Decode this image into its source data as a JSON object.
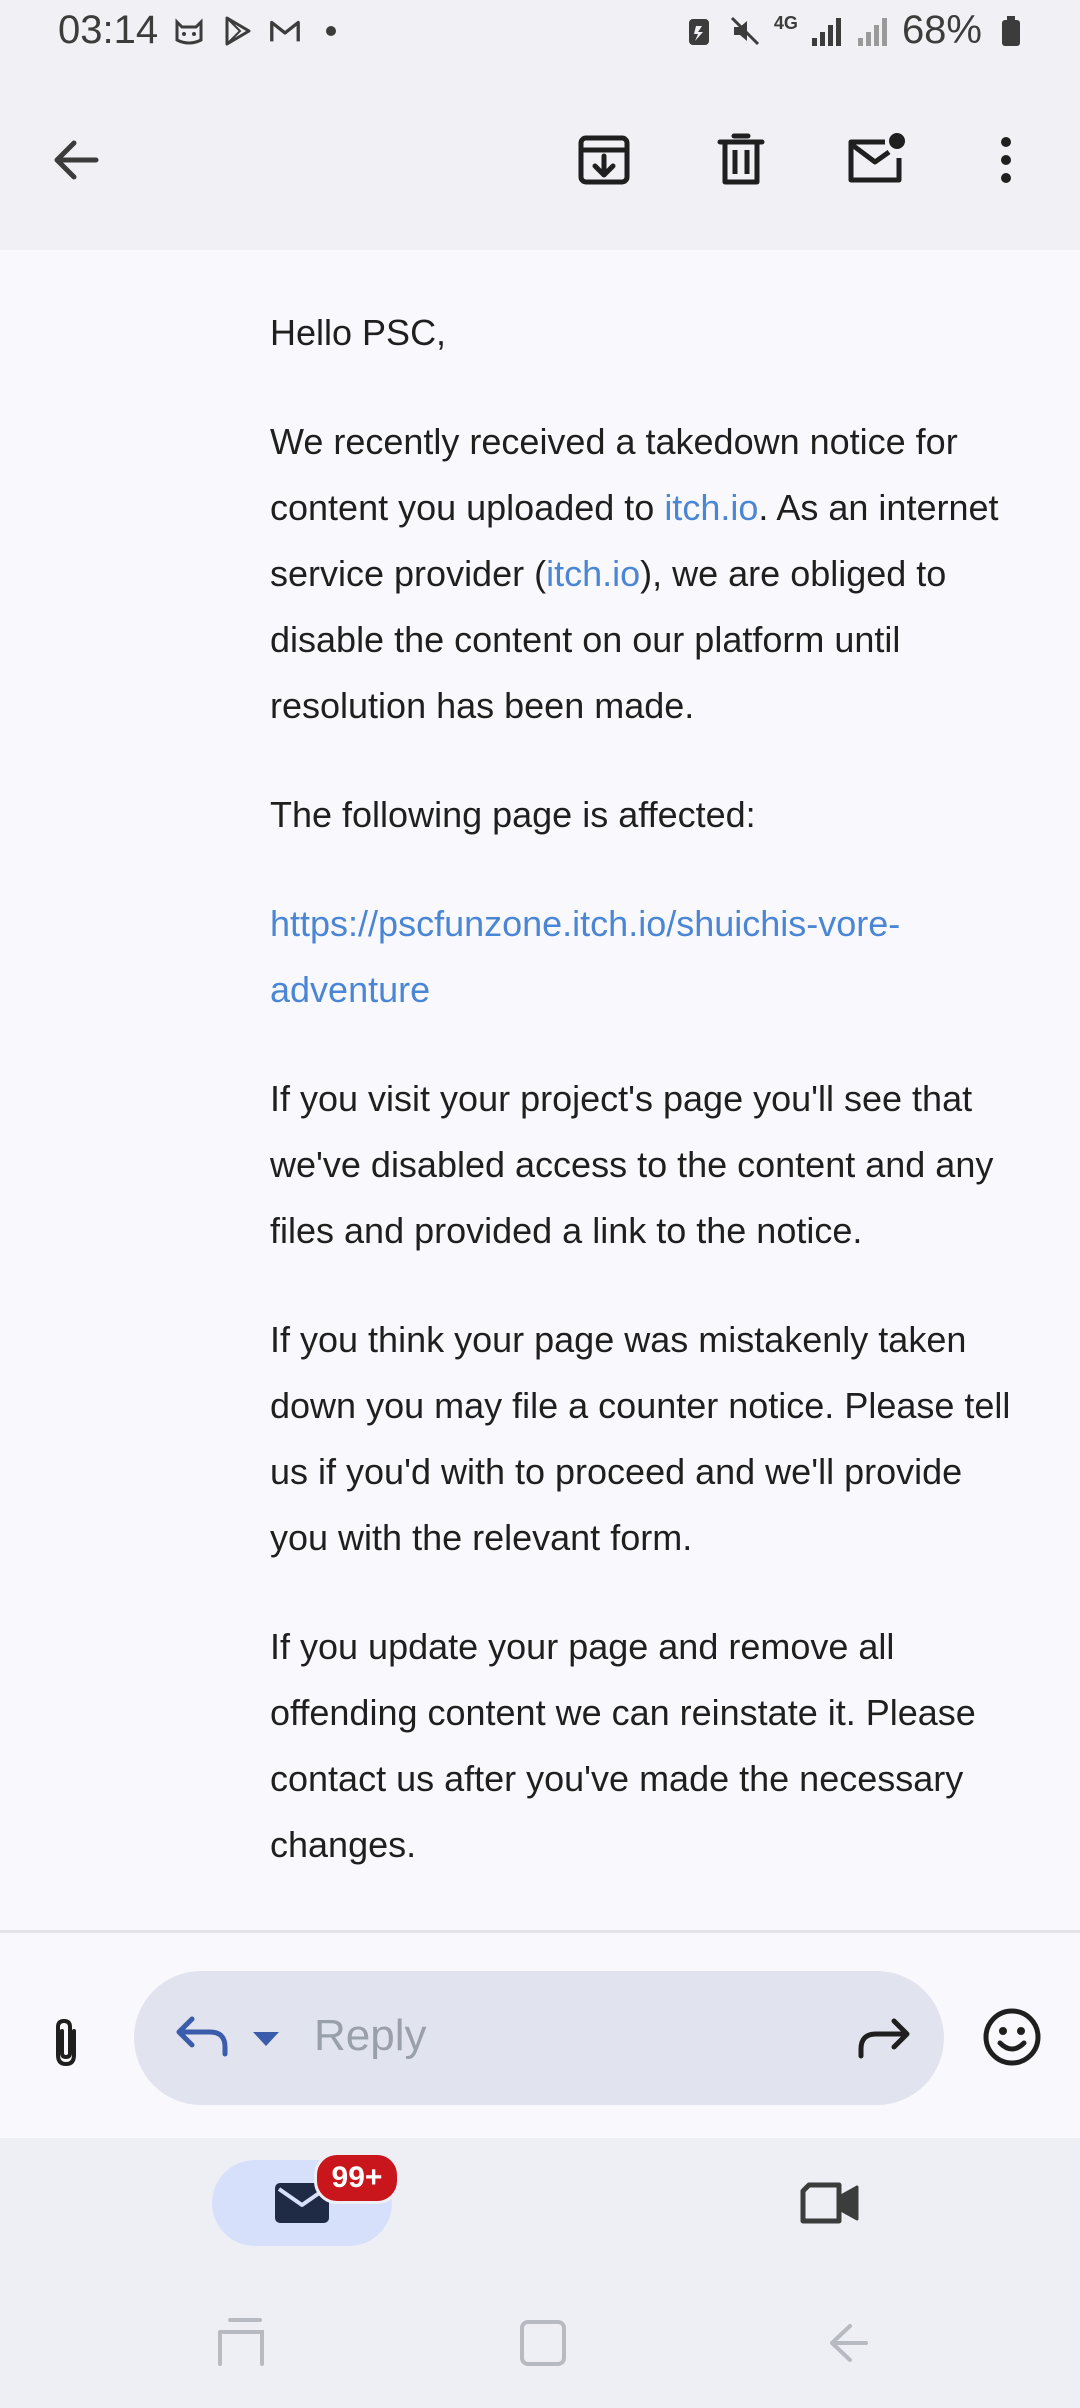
{
  "status_bar": {
    "time": "03:14",
    "network_label": "4G",
    "battery_percent": "68%"
  },
  "app_bar": {
    "icons": [
      "back-arrow-icon",
      "archive-icon",
      "trash-icon",
      "mark-unread-icon",
      "more-vert-icon"
    ]
  },
  "email": {
    "greeting": "Hello PSC,",
    "p1_a": "We recently received a takedown notice for content you uploaded to ",
    "p1_link1": "itch.io",
    "p1_b": ". As an internet service provider (",
    "p1_link2": "itch.io",
    "p1_c": "), we are obliged to disable the content on our platform until resolution has been made.",
    "affected_label": "The following page is affected:",
    "affected_url": "https://pscfunzone.itch.io/shuichis-vore-adventure",
    "p3": "If you visit your project's page you'll see that we've disabled access to the content and any files and provided a link to the notice.",
    "p4": "If you think your page was mistakenly taken down you may file a counter notice. Please tell us if you'd with to proceed and we'll provide you with the relevant form.",
    "p5": "If you update your page and remove all offending content we can reinstate it. Please contact us after you've made the necessary changes."
  },
  "reply_bar": {
    "placeholder": "Reply"
  },
  "bottom_nav": {
    "mail_badge": "99+"
  },
  "colors": {
    "link": "#4a86d4",
    "badge": "#c8161c",
    "accent_pill": "#d7e0fb",
    "reply_icon": "#3b5bab"
  }
}
